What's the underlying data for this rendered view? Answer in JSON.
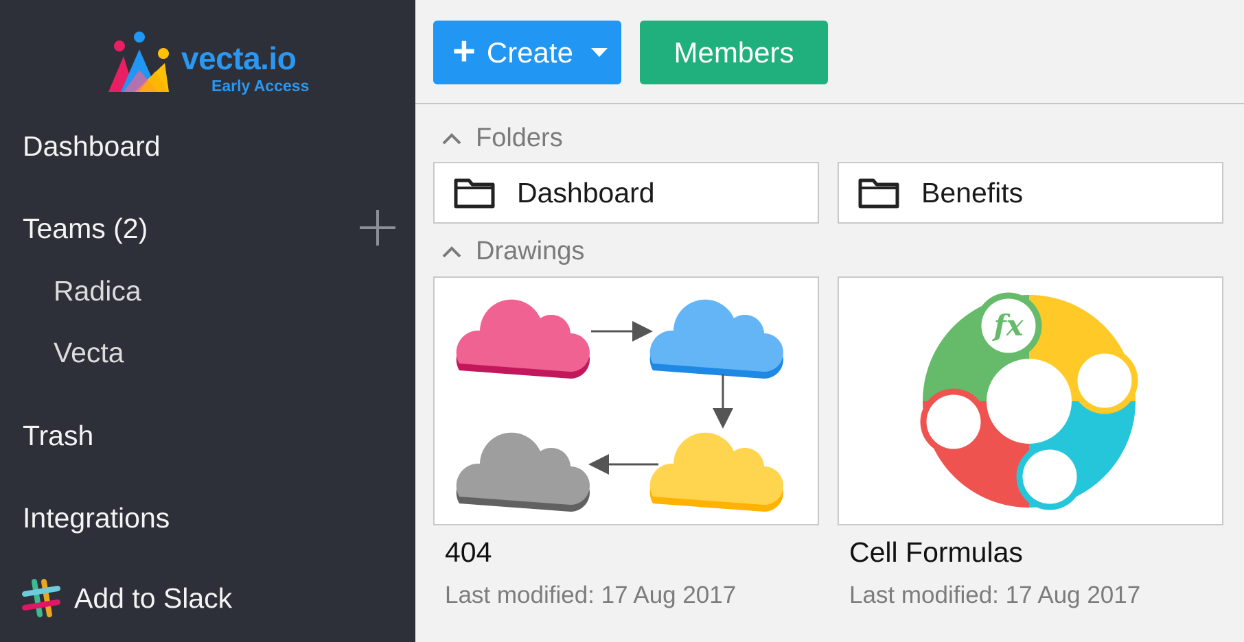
{
  "brand": {
    "name": "vecta.io",
    "tagline": "Early Access"
  },
  "sidebar": {
    "dashboard": "Dashboard",
    "teams": "Teams (2)",
    "teams_list": [
      "Radica",
      "Vecta"
    ],
    "trash": "Trash",
    "integrations": "Integrations",
    "slack": "Add to Slack"
  },
  "toolbar": {
    "create_label": "Create",
    "members_label": "Members"
  },
  "sections": {
    "folders": "Folders",
    "drawings": "Drawings"
  },
  "folders": [
    {
      "name": "Dashboard"
    },
    {
      "name": "Benefits"
    }
  ],
  "drawings": [
    {
      "title": "404",
      "modified": "Last modified: 17 Aug 2017"
    },
    {
      "title": "Cell Formulas",
      "modified": "Last modified: 17 Aug 2017"
    }
  ],
  "colors": {
    "sidebar_bg": "#2e3039",
    "create_button": "#2196f3",
    "members_button": "#20b07e",
    "brand_blue": "#2b97f0"
  }
}
